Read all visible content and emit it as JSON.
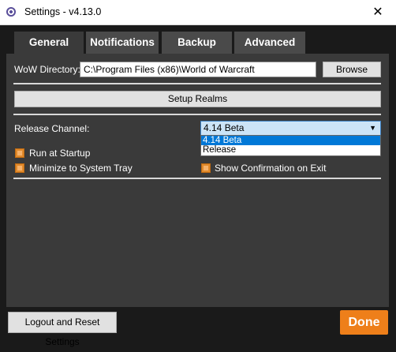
{
  "window": {
    "title": "Settings - v4.13.0",
    "close_glyph": "✕"
  },
  "tabs": [
    {
      "label": "General",
      "active": true
    },
    {
      "label": "Notifications",
      "active": false
    },
    {
      "label": "Backup",
      "active": false
    },
    {
      "label": "Advanced",
      "active": false
    }
  ],
  "general": {
    "wow_directory_label": "WoW Directory:",
    "wow_directory_value": "C:\\Program Files (x86)\\World of Warcraft",
    "browse_label": "Browse",
    "setup_realms_label": "Setup Realms",
    "release_channel_label": "Release Channel:",
    "release_channel_selected": "4.14 Beta",
    "release_channel_options": [
      "4.14 Beta",
      "Release"
    ],
    "run_at_startup_label": "Run at Startup",
    "minimize_to_tray_label": "Minimize to System Tray",
    "show_confirmation_label": "Show Confirmation on Exit"
  },
  "footer": {
    "logout_label": "Logout and Reset Settings",
    "done_label": "Done"
  },
  "colors": {
    "accent": "#ee7f1a",
    "panel": "#3a3a3a",
    "background": "#1a1a1a"
  },
  "icons": {
    "app": "app-logo-icon",
    "close": "close-icon",
    "dropdown": "chevron-down-icon"
  }
}
